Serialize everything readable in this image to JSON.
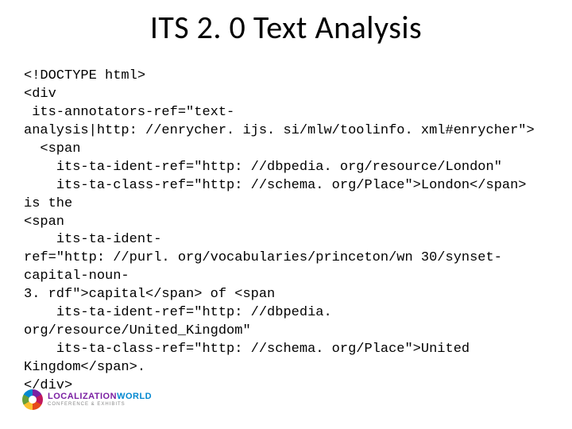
{
  "title": "ITS 2. 0 Text Analysis",
  "code": "<!DOCTYPE html>\n<div\n its-annotators-ref=\"text-\nanalysis|http: //enrycher. ijs. si/mlw/toolinfo. xml#enrycher\">\n  <span\n    its-ta-ident-ref=\"http: //dbpedia. org/resource/London\"\n    its-ta-class-ref=\"http: //schema. org/Place\">London</span> is the\n<span\n    its-ta-ident-\nref=\"http: //purl. org/vocabularies/princeton/wn 30/synset-capital-noun-\n3. rdf\">capital</span> of <span\n    its-ta-ident-ref=\"http: //dbpedia. org/resource/United_Kingdom\"\n    its-ta-class-ref=\"http: //schema. org/Place\">United Kingdom</span>.\n</div>",
  "logo": {
    "main_a": "LOCALIZATION",
    "main_b": "WORLD",
    "sub": "CONFERENCE & EXHIBITS"
  }
}
